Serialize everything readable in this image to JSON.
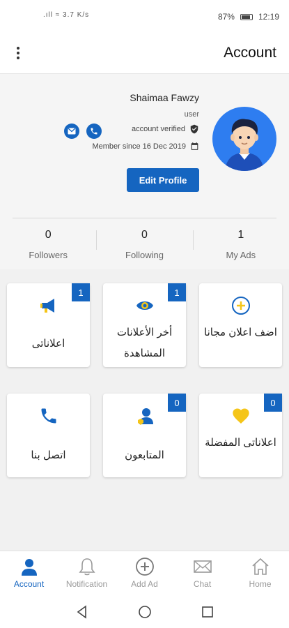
{
  "status_bar": {
    "left_text": ".ıll ≈ 3.7 K/s",
    "battery": "87%",
    "time": "12:19"
  },
  "appbar": {
    "title": "Account",
    "menu_icon": "more-vert-icon"
  },
  "profile": {
    "name": "Shaimaa Fawzy",
    "role": "user",
    "verified_text": "account verified",
    "member_since": "Member since 16 Dec 2019",
    "edit_label": "Edit Profile",
    "avatar_icon": "user-avatar-icon"
  },
  "stats": [
    {
      "value": "0",
      "label": "Followers"
    },
    {
      "value": "0",
      "label": "Following"
    },
    {
      "value": "1",
      "label": "My Ads"
    }
  ],
  "cards": [
    {
      "label": "اعلاناتى",
      "badge": "1",
      "icon": "megaphone-icon"
    },
    {
      "label": "أخر الأعلانات المشاهدة",
      "badge": "1",
      "icon": "eye-icon"
    },
    {
      "label": "اضف اعلان مجانا",
      "badge": "",
      "icon": "add-circle-icon"
    },
    {
      "label": "اتصل بنا",
      "badge": "",
      "icon": "phone-icon"
    },
    {
      "label": "المتابعون",
      "badge": "0",
      "icon": "followers-icon"
    },
    {
      "label": "اعلاناتى المفضلة",
      "badge": "0",
      "icon": "heart-icon"
    }
  ],
  "bottom_nav": [
    {
      "label": "Account",
      "icon": "person-icon",
      "active": true
    },
    {
      "label": "Notification",
      "icon": "bell-icon",
      "active": false
    },
    {
      "label": "Add Ad",
      "icon": "add-circle-icon",
      "active": false
    },
    {
      "label": "Chat",
      "icon": "mail-icon",
      "active": false
    },
    {
      "label": "Home",
      "icon": "home-icon",
      "active": false
    }
  ],
  "colors": {
    "primary": "#1565c0",
    "accent_yellow": "#f5c518",
    "avatar_bg": "#2e7df0"
  }
}
